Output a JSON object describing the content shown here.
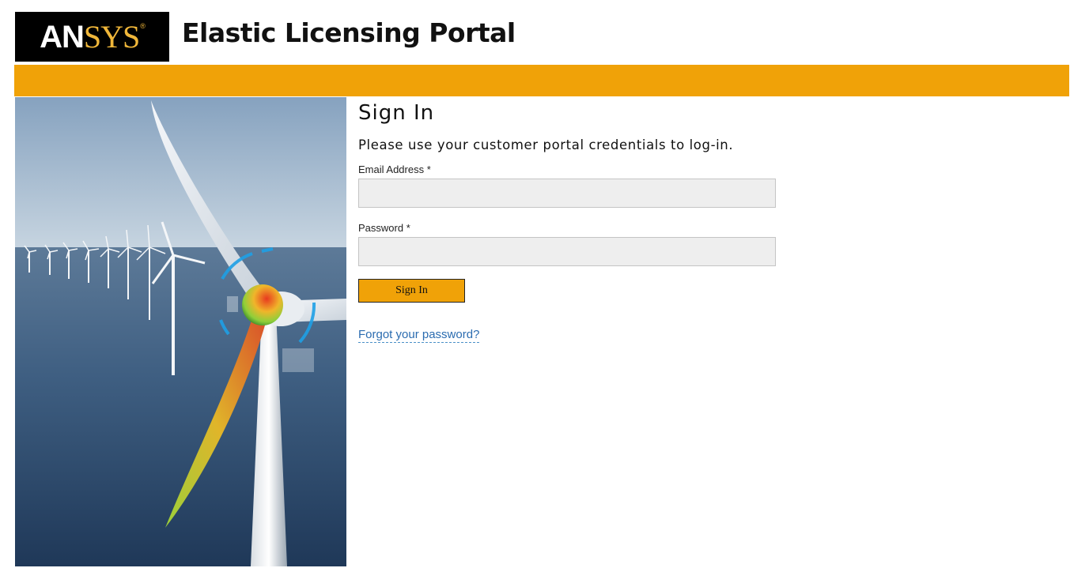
{
  "header": {
    "logo": {
      "primary": "AN",
      "secondary": "SYS",
      "registered": "®"
    },
    "title": "Elastic Licensing Portal"
  },
  "colors": {
    "accent": "#f0a208",
    "logo_bg": "#000000",
    "logo_gold": "#f0b73a",
    "link": "#2b6cb0"
  },
  "hero": {
    "icon": "wind-turbine-image"
  },
  "signin": {
    "heading": "Sign In",
    "subtitle": "Please use your customer portal credentials to log-in.",
    "email_label": "Email Address *",
    "email_value": "",
    "password_label": "Password *",
    "password_value": "",
    "button_label": "Sign In",
    "forgot_label": "Forgot your password?"
  }
}
